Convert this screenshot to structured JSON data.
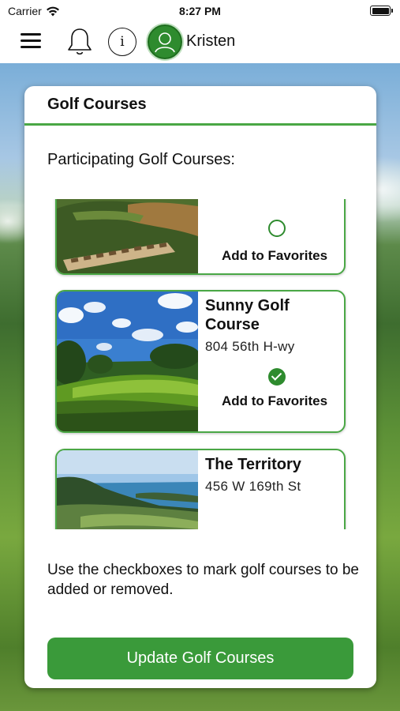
{
  "status_bar": {
    "carrier": "Carrier",
    "time": "8:27 PM"
  },
  "nav": {
    "user_name": "Kristen"
  },
  "card": {
    "title": "Golf Courses",
    "subtitle": "Participating Golf Courses:",
    "courses": [
      {
        "name": "",
        "address": "",
        "favorite": false,
        "favorite_label": "Add to Favorites"
      },
      {
        "name": "Sunny Golf Course",
        "address": "804 56th H-wy",
        "favorite": true,
        "favorite_label": "Add to Favorites"
      },
      {
        "name": "The Territory",
        "address": "456 W 169th St",
        "favorite": null,
        "favorite_label": ""
      }
    ],
    "instructions": "Use the checkboxes to mark golf courses to be added or removed.",
    "update_button": "Update Golf Courses"
  },
  "colors": {
    "accent_green": "#3a9a3a",
    "border_green": "#4aa745"
  }
}
